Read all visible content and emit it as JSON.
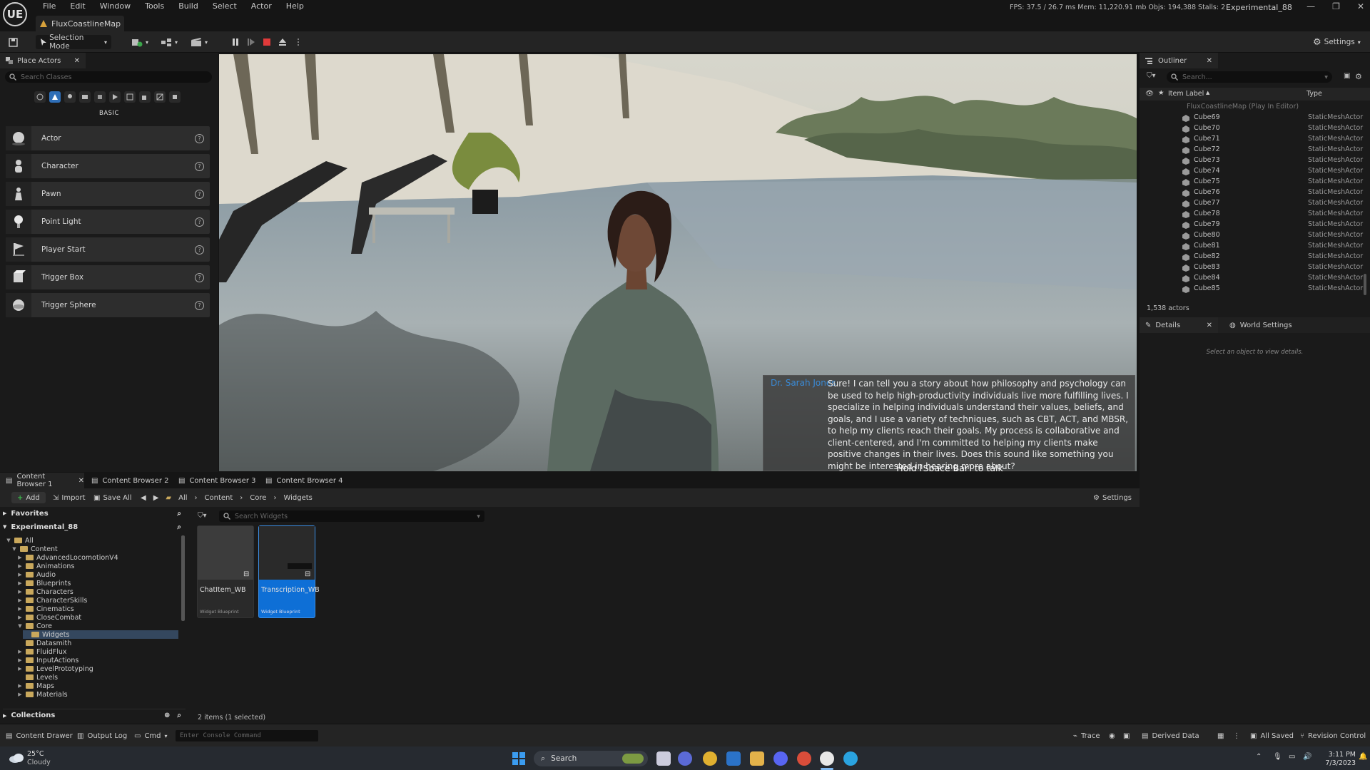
{
  "app": {
    "logo": "UE",
    "menu": [
      "File",
      "Edit",
      "Window",
      "Tools",
      "Build",
      "Select",
      "Actor",
      "Help"
    ],
    "map_tab": "FluxCoastlineMap",
    "stats": "FPS: 37.5  /  26.7 ms   Mem: 11,220.91 mb   Objs: 194,388   Stalls: 2",
    "project": "Experimental_88"
  },
  "toolbar": {
    "selection_mode": "Selection Mode",
    "settings": "Settings"
  },
  "place_actors": {
    "tab": "Place Actors",
    "search_placeholder": "Search Classes",
    "section": "BASIC",
    "items": [
      "Actor",
      "Character",
      "Pawn",
      "Point Light",
      "Player Start",
      "Trigger Box",
      "Trigger Sphere"
    ]
  },
  "viewport": {
    "speaker": "Dr. Sarah Jones",
    "subtitle": "Sure! I can tell you a story about how philosophy and psychology can be used to help high-productivity individuals live more fulfilling lives. I specialize in helping individuals understand their values, beliefs, and goals, and I use a variety of techniques, such as CBT, ACT, and MBSR, to help my clients reach their goals. My process is collaborative and client-centered, and I'm committed to helping my clients make positive changes in their lives. Does this sound like something you might be interested in hearing more about?",
    "hint": "Hold [Space Bar] to talk"
  },
  "outliner": {
    "tab": "Outliner",
    "search_placeholder": "Search...",
    "col_label": "Item Label",
    "col_type": "Type",
    "root": "FluxCoastlineMap (Play In Editor)",
    "rows": [
      {
        "name": "Cube69",
        "type": "StaticMeshActor"
      },
      {
        "name": "Cube70",
        "type": "StaticMeshActor"
      },
      {
        "name": "Cube71",
        "type": "StaticMeshActor"
      },
      {
        "name": "Cube72",
        "type": "StaticMeshActor"
      },
      {
        "name": "Cube73",
        "type": "StaticMeshActor"
      },
      {
        "name": "Cube74",
        "type": "StaticMeshActor"
      },
      {
        "name": "Cube75",
        "type": "StaticMeshActor"
      },
      {
        "name": "Cube76",
        "type": "StaticMeshActor"
      },
      {
        "name": "Cube77",
        "type": "StaticMeshActor"
      },
      {
        "name": "Cube78",
        "type": "StaticMeshActor"
      },
      {
        "name": "Cube79",
        "type": "StaticMeshActor"
      },
      {
        "name": "Cube80",
        "type": "StaticMeshActor"
      },
      {
        "name": "Cube81",
        "type": "StaticMeshActor"
      },
      {
        "name": "Cube82",
        "type": "StaticMeshActor"
      },
      {
        "name": "Cube83",
        "type": "StaticMeshActor"
      },
      {
        "name": "Cube84",
        "type": "StaticMeshActor"
      },
      {
        "name": "Cube85",
        "type": "StaticMeshActor"
      }
    ],
    "count": "1,538 actors"
  },
  "details": {
    "tab": "Details",
    "world_tab": "World Settings",
    "hint": "Select an object to view details."
  },
  "content_browser": {
    "tabs": [
      "Content Browser 1",
      "Content Browser 2",
      "Content Browser 3",
      "Content Browser 4"
    ],
    "add": "Add",
    "import": "Import",
    "save_all": "Save All",
    "breadcrumb": [
      "All",
      "Content",
      "Core",
      "Widgets"
    ],
    "settings": "Settings",
    "favorites": "Favorites",
    "project": "Experimental_88",
    "tree_all": "All",
    "tree_content": "Content",
    "folders": [
      "AdvancedLocomotionV4",
      "Animations",
      "Audio",
      "Blueprints",
      "Characters",
      "CharacterSkills",
      "Cinematics",
      "CloseCombat",
      "Core",
      "Widgets",
      "Datasmith",
      "FluidFlux",
      "InputActions",
      "LevelPrototyping",
      "Levels",
      "Maps",
      "Materials"
    ],
    "collections": "Collections",
    "search_placeholder": "Search Widgets",
    "assets": [
      {
        "name": "ChatItem_WB",
        "type": "Widget Blueprint"
      },
      {
        "name": "Transcription_WB",
        "type": "Widget Blueprint"
      }
    ],
    "items_status": "2 items (1 selected)"
  },
  "statusbar": {
    "content_drawer": "Content Drawer",
    "output_log": "Output Log",
    "cmd": "Cmd",
    "console_placeholder": "Enter Console Command",
    "trace": "Trace",
    "derived_data": "Derived Data",
    "all_saved": "All Saved",
    "revision_control": "Revision Control"
  },
  "taskbar": {
    "temp": "25°C",
    "weather": "Cloudy",
    "search": "Search",
    "time": "3:11 PM",
    "date": "7/3/2023"
  },
  "colors": {
    "accent": "#0e6fd6",
    "speaker": "#3a8ad6",
    "stop": "#e03a3a",
    "folder": "#c9a85c"
  }
}
